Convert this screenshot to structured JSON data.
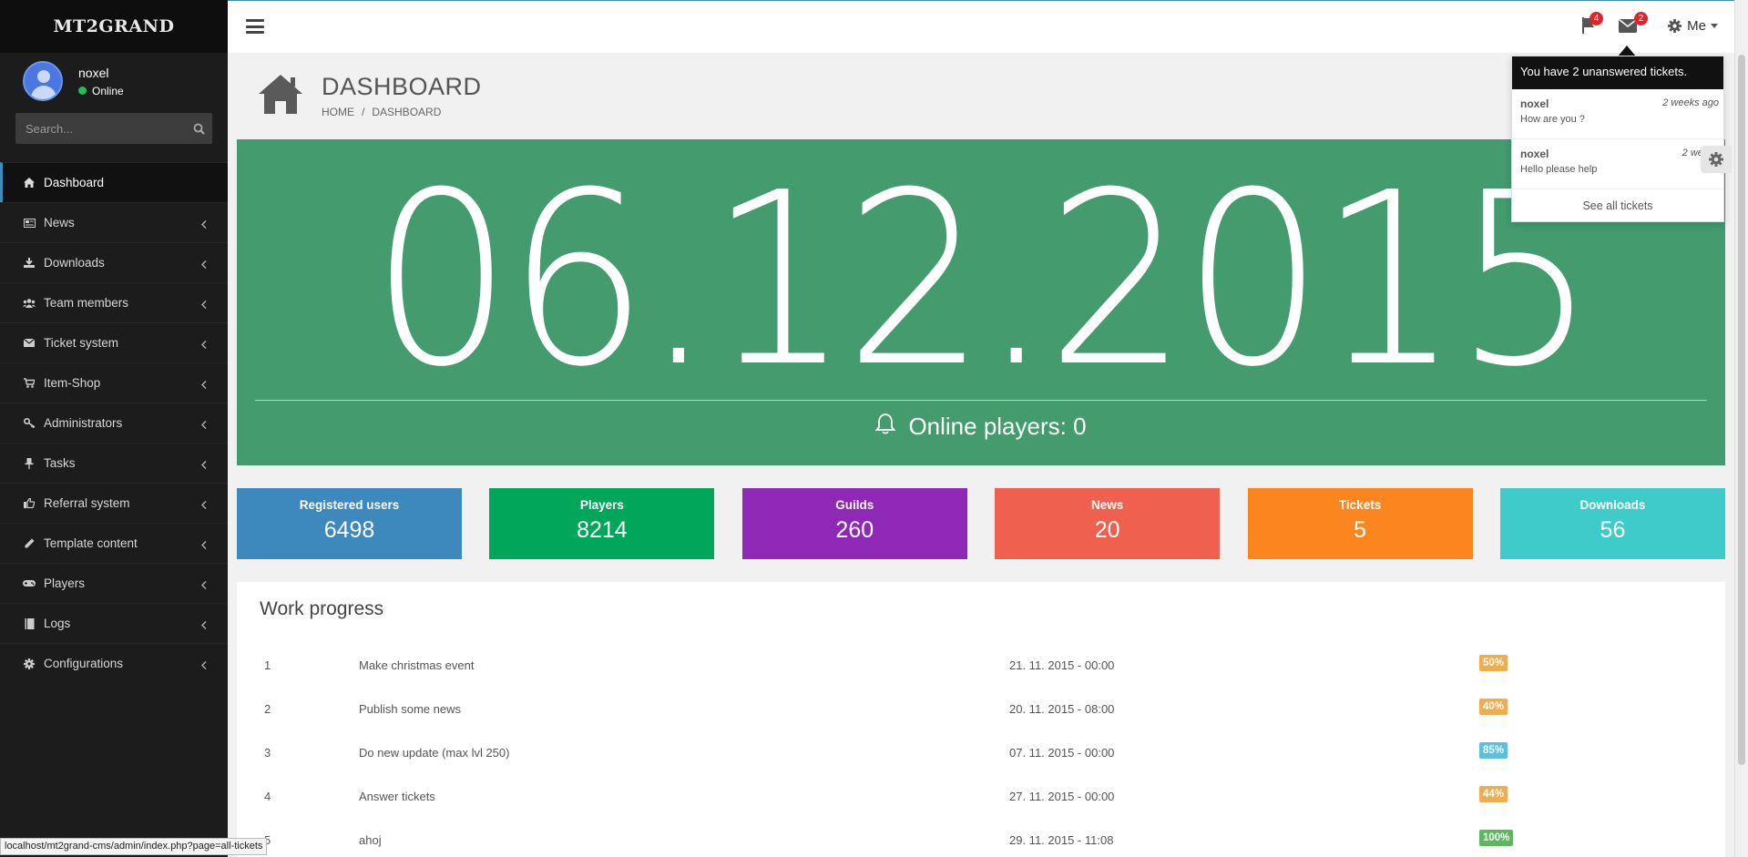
{
  "app": {
    "logo": "MT2GRAND"
  },
  "user": {
    "name": "noxel",
    "status": "Online"
  },
  "search": {
    "placeholder": "Search..."
  },
  "sidebar": {
    "items": [
      {
        "label": "Dashboard",
        "icon": "home-icon"
      },
      {
        "label": "News",
        "icon": "newspaper-icon"
      },
      {
        "label": "Downloads",
        "icon": "download-icon"
      },
      {
        "label": "Team members",
        "icon": "users-icon"
      },
      {
        "label": "Ticket system",
        "icon": "envelope-icon"
      },
      {
        "label": "Item-Shop",
        "icon": "cart-icon"
      },
      {
        "label": "Administrators",
        "icon": "key-icon"
      },
      {
        "label": "Tasks",
        "icon": "pin-icon"
      },
      {
        "label": "Referral system",
        "icon": "thumbs-up-icon"
      },
      {
        "label": "Template content",
        "icon": "pencil-icon"
      },
      {
        "label": "Players",
        "icon": "gamepad-icon"
      },
      {
        "label": "Logs",
        "icon": "book-icon"
      },
      {
        "label": "Configurations",
        "icon": "gear-icon"
      }
    ]
  },
  "topbar": {
    "flag_badge": "4",
    "mail_badge": "2",
    "me_label": "Me"
  },
  "tickets_dropdown": {
    "header": "You have 2 unanswered tickets.",
    "items": [
      {
        "name": "noxel",
        "message": "How are you ?",
        "time": "2 weeks ago"
      },
      {
        "name": "noxel",
        "message": "Hello please help",
        "time": "2 weeks"
      }
    ],
    "footer": "See all tickets"
  },
  "page": {
    "title": "DASHBOARD",
    "breadcrumb": [
      "HOME",
      "DASHBOARD"
    ]
  },
  "hero": {
    "date": "06.12.2015",
    "online_label": "Online players: 0",
    "color": "#439b6e"
  },
  "stats": [
    {
      "label": "Registered users",
      "value": "6498",
      "color": "#3d88bd"
    },
    {
      "label": "Players",
      "value": "8214",
      "color": "#00a65a"
    },
    {
      "label": "Guilds",
      "value": "260",
      "color": "#8f28b6"
    },
    {
      "label": "News",
      "value": "20",
      "color": "#f0604f"
    },
    {
      "label": "Tickets",
      "value": "5",
      "color": "#fb861f"
    },
    {
      "label": "Downloads",
      "value": "56",
      "color": "#3ecbca"
    }
  ],
  "work_progress": {
    "title": "Work progress",
    "rows": [
      {
        "num": "1",
        "task": "Make christmas event",
        "date": "21. 11. 2015 - 00:00",
        "progress": "50%",
        "color": "#f0ad4e"
      },
      {
        "num": "2",
        "task": "Publish some news",
        "date": "20. 11. 2015 - 08:00",
        "progress": "40%",
        "color": "#f0ad4e"
      },
      {
        "num": "3",
        "task": "Do new update (max lvl 250)",
        "date": "07. 11. 2015 - 00:00",
        "progress": "85%",
        "color": "#5bc0de"
      },
      {
        "num": "4",
        "task": "Answer tickets",
        "date": "27. 11. 2015 - 00:00",
        "progress": "44%",
        "color": "#f0ad4e"
      },
      {
        "num": "5",
        "task": "ahoj",
        "date": "29. 11. 2015 - 11:08",
        "progress": "100%",
        "color": "#5cb85c"
      }
    ]
  },
  "statusbar": {
    "url": "localhost/mt2grand-cms/admin/index.php?page=all-tickets"
  }
}
